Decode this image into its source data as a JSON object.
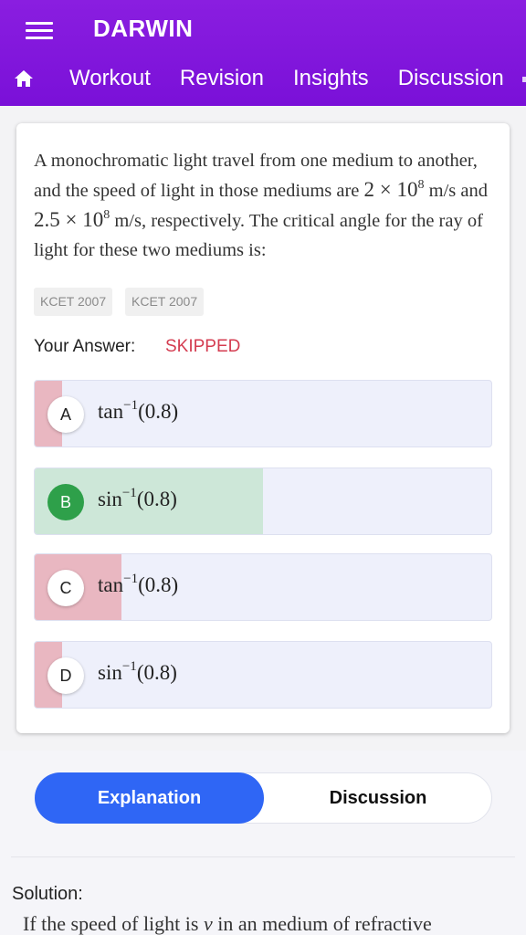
{
  "app": {
    "title": "DARWIN"
  },
  "nav": {
    "tabs": [
      "Workout",
      "Revision",
      "Insights",
      "Discussion"
    ]
  },
  "question": {
    "p1": "A monochromatic light travel from one medium to another, and the speed of light in those mediums are ",
    "m1": "2 × 10",
    "m1_exp": "8",
    "p2": " m/s and ",
    "m2": "2.5 × 10",
    "m2_exp": "8",
    "p3": " m/s, respectively. The critical angle for the ray of light for these two mediums is:",
    "tags": [
      "KCET 2007",
      "KCET 2007"
    ]
  },
  "answer": {
    "label": "Your Answer:",
    "value": "SKIPPED",
    "value_color": "#d43c50"
  },
  "options": [
    {
      "letter": "A",
      "fn": "tan",
      "exp": "−1",
      "arg": "(0.8)",
      "share": 0.06,
      "correct": false
    },
    {
      "letter": "B",
      "fn": "sin",
      "exp": "−1",
      "arg": "(0.8)",
      "share": 0.5,
      "correct": true
    },
    {
      "letter": "C",
      "fn": "tan",
      "exp": "−1",
      "arg": "(0.8)",
      "share": 0.19,
      "correct": false
    },
    {
      "letter": "D",
      "fn": "sin",
      "exp": "−1",
      "arg": "(0.8)",
      "share": 0.06,
      "correct": false
    }
  ],
  "colors": {
    "header": "#7a10d8",
    "correct_fill": "#cde7d8",
    "wrong_fill": "#e9b7c1",
    "active_tab": "#2f66f5",
    "correct_badge": "#2ea04a"
  },
  "tabs": {
    "explanation": "Explanation",
    "discussion": "Discussion"
  },
  "solution": {
    "label": "Solution:",
    "text": "If the speed of light is v in an medium of refractive"
  }
}
